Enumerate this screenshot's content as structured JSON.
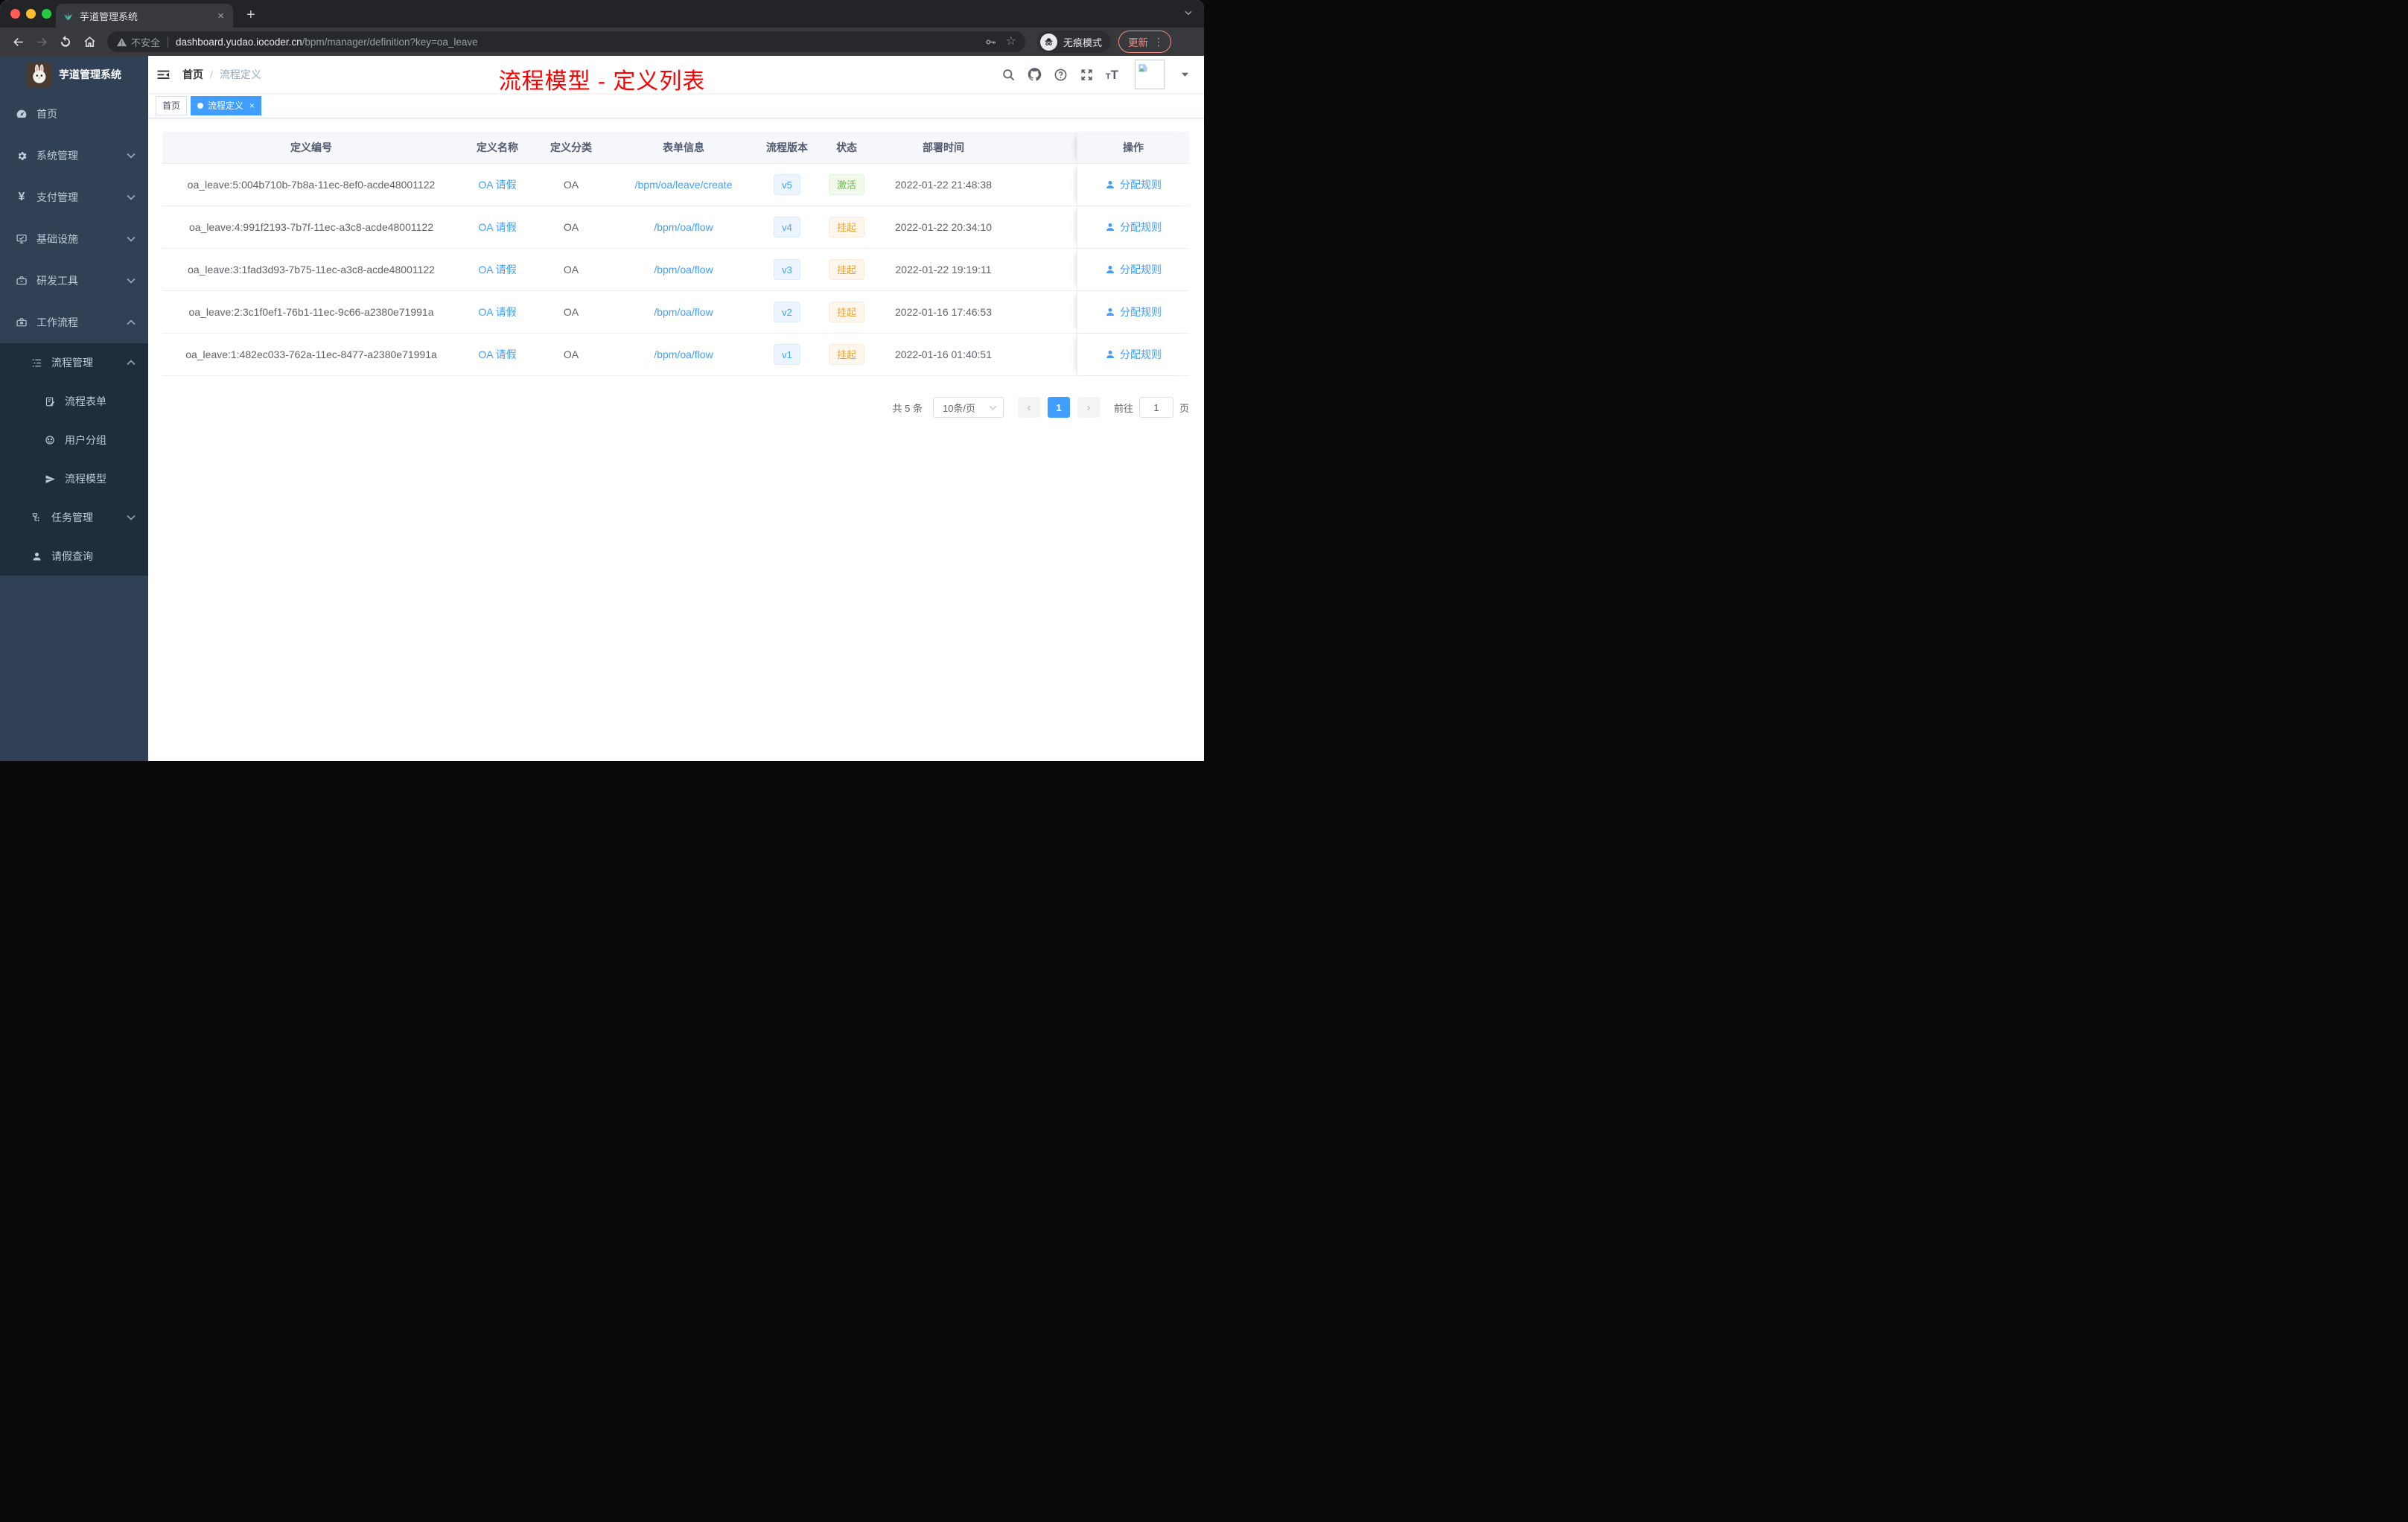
{
  "browser": {
    "tab_title": "芋道管理系统",
    "security_label": "不安全",
    "url_domain": "dashboard.yudao.iocoder.cn",
    "url_path": "/bpm/manager/definition?key=oa_leave",
    "incognito_label": "无痕模式",
    "update_label": "更新"
  },
  "icons": {
    "tab_close": "×",
    "new_tab": "+",
    "star": "☆",
    "dots": "⋮",
    "tag_close": "×",
    "prev": "‹",
    "next": "›"
  },
  "sidebar": {
    "logo_title": "芋道管理系统",
    "items": [
      {
        "label": "首页"
      },
      {
        "label": "系统管理"
      },
      {
        "label": "支付管理"
      },
      {
        "label": "基础设施"
      },
      {
        "label": "研发工具"
      },
      {
        "label": "工作流程"
      },
      {
        "label": "流程管理"
      },
      {
        "label": "流程表单"
      },
      {
        "label": "用户分组"
      },
      {
        "label": "流程模型"
      },
      {
        "label": "任务管理"
      },
      {
        "label": "请假查询"
      }
    ]
  },
  "header": {
    "breadcrumb_home": "首页",
    "breadcrumb_separator": "/",
    "breadcrumb_current": "流程定义"
  },
  "tags": {
    "home": "首页",
    "active": "流程定义"
  },
  "annotation": "流程模型 - 定义列表",
  "table": {
    "columns": [
      "定义编号",
      "定义名称",
      "定义分类",
      "表单信息",
      "流程版本",
      "状态",
      "部署时间",
      "操作"
    ],
    "rows": [
      {
        "id": "oa_leave:5:004b710b-7b8a-11ec-8ef0-acde48001122",
        "name": "OA 请假",
        "category": "OA",
        "form": "/bpm/oa/leave/create",
        "version": "v5",
        "status": "激活",
        "status_type": "success",
        "deployed": "2022-01-22 21:48:38",
        "action": "分配规则"
      },
      {
        "id": "oa_leave:4:991f2193-7b7f-11ec-a3c8-acde48001122",
        "name": "OA 请假",
        "category": "OA",
        "form": "/bpm/oa/flow",
        "version": "v4",
        "status": "挂起",
        "status_type": "warning",
        "deployed": "2022-01-22 20:34:10",
        "action": "分配规则"
      },
      {
        "id": "oa_leave:3:1fad3d93-7b75-11ec-a3c8-acde48001122",
        "name": "OA 请假",
        "category": "OA",
        "form": "/bpm/oa/flow",
        "version": "v3",
        "status": "挂起",
        "status_type": "warning",
        "deployed": "2022-01-22 19:19:11",
        "action": "分配规则"
      },
      {
        "id": "oa_leave:2:3c1f0ef1-76b1-11ec-9c66-a2380e71991a",
        "name": "OA 请假",
        "category": "OA",
        "form": "/bpm/oa/flow",
        "version": "v2",
        "status": "挂起",
        "status_type": "warning",
        "deployed": "2022-01-16 17:46:53",
        "action": "分配规则"
      },
      {
        "id": "oa_leave:1:482ec033-762a-11ec-8477-a2380e71991a",
        "name": "OA 请假",
        "category": "OA",
        "form": "/bpm/oa/flow",
        "version": "v1",
        "status": "挂起",
        "status_type": "warning",
        "deployed": "2022-01-16 01:40:51",
        "action": "分配规则"
      }
    ]
  },
  "pagination": {
    "total": "共 5 条",
    "page_size": "10条/页",
    "current_page": "1",
    "goto_label": "前往",
    "goto_value": "1",
    "page_unit": "页"
  },
  "colors": {
    "accent": "#409eff",
    "success": "#67c23a",
    "warning": "#e6a23c",
    "annotation_red": "#ff0000",
    "sidebar_bg": "#304156",
    "submenu_bg": "#1f2d3d"
  }
}
